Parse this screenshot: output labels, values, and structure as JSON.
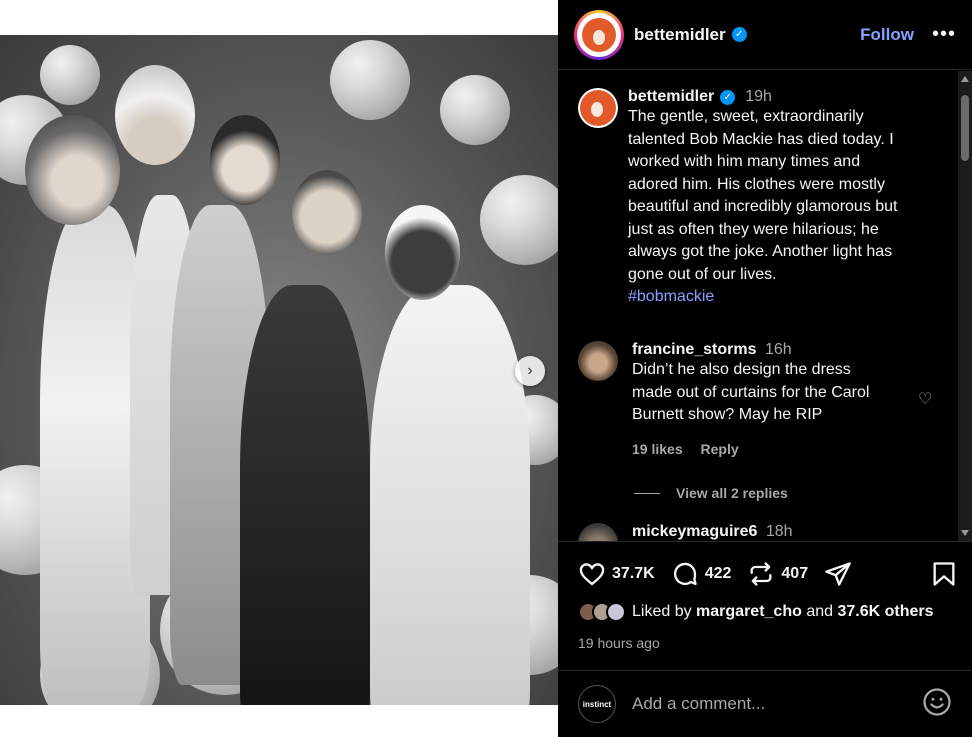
{
  "post": {
    "username": "bettemidler",
    "follow_label": "Follow",
    "more_label": "•••",
    "caption": {
      "username": "bettemidler",
      "time": "19h",
      "lines": [
        "The gentle, sweet, extraordinarily",
        "talented Bob Mackie has died today.  I",
        "worked with him many times and",
        "adored him.  His clothes were mostly",
        "beautiful and incredibly glamorous but",
        "just as often they were hilarious; he",
        "always got the joke.  Another light has",
        "gone out of our lives."
      ],
      "hashtag": "#bobmackie"
    },
    "comments": [
      {
        "username": "francine_storms",
        "time": "16h",
        "lines": [
          "Didn’t he also design the dress",
          "made out of curtains for the Carol",
          "Burnett show? May he RIP"
        ],
        "likes": "19 likes",
        "reply_label": "Reply",
        "view_replies": "View all 2 replies"
      },
      {
        "username": "mickeymaguire6",
        "time": "18h"
      }
    ],
    "actions": {
      "likes": "37.7K",
      "comments": "422",
      "reposts": "407"
    },
    "liked_by": {
      "prefix": "Liked by",
      "user": "margaret_cho",
      "middle": "and",
      "others": "37.6K others"
    },
    "timestamp": "19 hours ago",
    "comment_input": {
      "placeholder": "Add a comment...",
      "avatar_text": "instinct"
    }
  },
  "colors": {
    "background": "#000000",
    "accent_link": "#85a1ff",
    "verified": "#0095f6",
    "muted": "#a8a8a8"
  },
  "icons": [
    "heart-icon",
    "comment-icon",
    "repost-icon",
    "share-icon",
    "bookmark-icon",
    "emoji-icon",
    "verified-icon",
    "chevron-right-icon",
    "more-icon"
  ]
}
